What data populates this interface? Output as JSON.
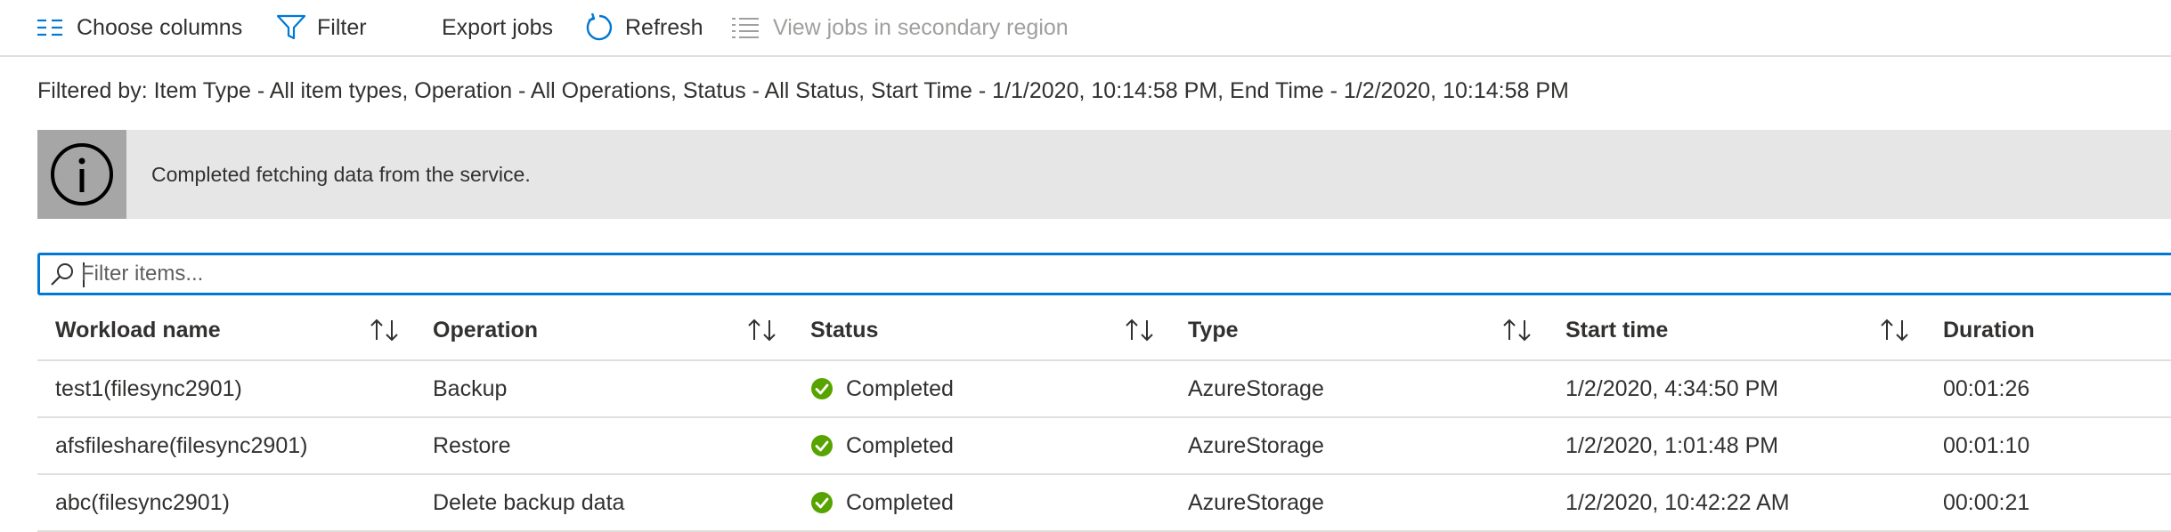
{
  "toolbar": {
    "choose_columns": "Choose columns",
    "filter": "Filter",
    "export_jobs": "Export jobs",
    "refresh": "Refresh",
    "view_secondary": "View jobs in secondary region"
  },
  "filtered_by": "Filtered by: Item Type - All item types, Operation - All Operations, Status - All Status, Start Time - 1/1/2020, 10:14:58 PM, End Time - 1/2/2020, 10:14:58 PM",
  "info": {
    "message": "Completed fetching data from the service.",
    "icon": "info-icon"
  },
  "search": {
    "placeholder": "Filter items...",
    "value": ""
  },
  "columns": [
    "Workload name",
    "Operation",
    "Status",
    "Type",
    "Start time",
    "Duration"
  ],
  "rows": [
    {
      "workload": "test1(filesync2901)",
      "operation": "Backup",
      "status": "Completed",
      "type": "AzureStorage",
      "start": "1/2/2020, 4:34:50 PM",
      "duration": "00:01:26"
    },
    {
      "workload": "afsfileshare(filesync2901)",
      "operation": "Restore",
      "status": "Completed",
      "type": "AzureStorage",
      "start": "1/2/2020, 1:01:48 PM",
      "duration": "00:01:10"
    },
    {
      "workload": "abc(filesync2901)",
      "operation": "Delete backup data",
      "status": "Completed",
      "type": "AzureStorage",
      "start": "1/2/2020, 10:42:22 AM",
      "duration": "00:00:21"
    }
  ],
  "colors": {
    "accent": "#0078d4",
    "success": "#57a300",
    "disabled": "#a19f9d"
  }
}
